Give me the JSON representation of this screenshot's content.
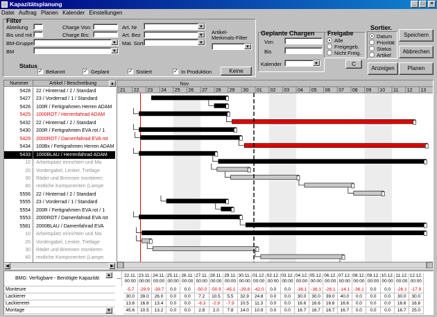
{
  "window": {
    "title": "Kapazitätsplanung",
    "min": "_",
    "max": "□",
    "close": "×"
  },
  "menu": [
    "Datei",
    "Auftrag",
    "Planen",
    "Kalender",
    "Einstellungen"
  ],
  "filter": {
    "heading": "Filter",
    "abteilung": "Abteilung",
    "bis_und_mit": "Bis und mit",
    "charge_von": "Charge Von:",
    "charge_bis": "Charge Bis:",
    "bm_gruppe": "BM-Gruppe",
    "bm": "BM",
    "art_nr": "Art. Nr",
    "art_bez": "Art. Bez",
    "mat_sorte": "Mat. Sorte",
    "artikel_merkmals_filter": [
      "Artikel-",
      "Merkmals-Filter"
    ]
  },
  "status": {
    "heading": "Status",
    "checks": [
      {
        "label": "Bekannt",
        "checked": true
      },
      {
        "label": "Geplant",
        "checked": true
      },
      {
        "label": "Sistiert",
        "checked": true
      },
      {
        "label": "In Produktion",
        "checked": true
      }
    ],
    "none_button": "Keine"
  },
  "geplante_chargen": {
    "heading": "Geplante Chargen",
    "von": "Von",
    "bis": "Bis",
    "kalender": "Kalender",
    "c_button": "C"
  },
  "freigabe": {
    "heading": "Freigabe",
    "options": [
      {
        "label": "Alle",
        "selected": true
      },
      {
        "label": "Freigegeb.",
        "selected": false
      },
      {
        "label": "Nicht Freig.",
        "selected": false
      }
    ]
  },
  "sortier": {
    "heading": "Sortier.",
    "options": [
      {
        "label": "Datum",
        "selected": true
      },
      {
        "label": "Priorität",
        "selected": false
      },
      {
        "label": "Status",
        "selected": false
      },
      {
        "label": "Artikel",
        "selected": false
      }
    ]
  },
  "buttons": {
    "speichern": "Speichern",
    "abbrechen": "Abbrechen",
    "anzeigen": "Anzeigen",
    "planen": "Planen"
  },
  "list": {
    "col_nummer": "Nummer",
    "col_artikel": "Artikel / Beschreibung",
    "rows": [
      {
        "num": "5428",
        "text": "22 / Hinterrad / 2 / Standard",
        "kind": "normal"
      },
      {
        "num": "5427",
        "text": "23 / Vorderrad / 1 / Standard",
        "kind": "normal"
      },
      {
        "num": "5426",
        "text": "100R / Fertigrahmen Herren ADAM",
        "kind": "normal"
      },
      {
        "num": "5425",
        "text": "1000ROT / Herrenfahrad ADAM",
        "kind": "red"
      },
      {
        "num": "5432",
        "text": "22 / Hinterrad / 2 / Standard",
        "kind": "normal"
      },
      {
        "num": "5430",
        "text": "200R / Fertigrahmen EVA rot / 1",
        "kind": "normal"
      },
      {
        "num": "5429",
        "text": "2000ROT / Damenfahrad EVA rot",
        "kind": "red"
      },
      {
        "num": "5434",
        "text": "100Bx / Fertigrahmen Herren ADAM",
        "kind": "normal"
      },
      {
        "num": "5433",
        "text": "1000BLAU / Herrenfahrad ADAM",
        "kind": "sel"
      },
      {
        "num": "10",
        "text": "Arbeitsplatz einrichten und Ma",
        "kind": "sub"
      },
      {
        "num": "20",
        "text": "Vordergabel, Lenker, Tretlage",
        "kind": "sub"
      },
      {
        "num": "30",
        "text": "Räder und Bremsen montieren",
        "kind": "sub"
      },
      {
        "num": "40",
        "text": "restliche Komponenten (Lampe",
        "kind": "sub"
      },
      {
        "num": "5556",
        "text": "22 / Hinterrad / 2 / Standard",
        "kind": "normal"
      },
      {
        "num": "5555",
        "text": "23 / Vorderrad / 1 / Standard",
        "kind": "normal"
      },
      {
        "num": "5554",
        "text": "200R / Fertigrahmen EVA rot / 1",
        "kind": "normal"
      },
      {
        "num": "5553",
        "text": "2000ROT / Damenfahrad EVA rot",
        "kind": "normal"
      },
      {
        "num": "5581",
        "text": "2000BLAU / Damenfahrad EVA",
        "kind": "normal"
      },
      {
        "num": "10",
        "text": "Arbeitsplatz einrichten und Ma",
        "kind": "sub"
      },
      {
        "num": "20",
        "text": "Vordergabel, Lenker, Tretlage",
        "kind": "sub"
      },
      {
        "num": "30",
        "text": "Räder und Bremsen montieren",
        "kind": "sub"
      },
      {
        "num": "40",
        "text": "restliche Komponenten (Lampe",
        "kind": "sub"
      }
    ]
  },
  "gantt": {
    "month": "Nov",
    "days": [
      "21",
      "22",
      "23",
      "24",
      "25",
      "26",
      "27",
      "28",
      "29",
      "30",
      "01",
      "02",
      "03",
      "04",
      "05",
      "06",
      "07",
      "08",
      "09",
      "10",
      "11",
      "12",
      "13"
    ],
    "bars": [
      {
        "row": 0,
        "start": 2.4,
        "end": 8.0,
        "color": "black"
      },
      {
        "row": 1,
        "start": 7.0,
        "end": 8.0,
        "color": "black"
      },
      {
        "row": 2,
        "start": 1.5,
        "end": 8.1,
        "color": "black"
      },
      {
        "row": 3,
        "start": 8.3,
        "end": 21.7,
        "color": "red"
      },
      {
        "row": 4,
        "start": 1.5,
        "end": 8.6,
        "color": "black"
      },
      {
        "row": 5,
        "start": 1.6,
        "end": 9.0,
        "color": "black"
      },
      {
        "row": 6,
        "start": 9.2,
        "end": 22.6,
        "color": "red"
      },
      {
        "row": 7,
        "start": 1.5,
        "end": 7.2,
        "color": "black"
      },
      {
        "row": 8,
        "start": 7.3,
        "end": 22.5,
        "color": "black"
      },
      {
        "row": 9,
        "start": 7.2,
        "end": 9.6,
        "color": "gray"
      },
      {
        "row": 10,
        "start": 8.2,
        "end": 13.2,
        "color": "gray"
      },
      {
        "row": 11,
        "start": 13.6,
        "end": 17.2,
        "color": "gray"
      },
      {
        "row": 12,
        "start": 17.2,
        "end": 19.4,
        "color": "gray"
      },
      {
        "row": 13,
        "start": 3.5,
        "end": 8.0,
        "color": "black"
      },
      {
        "row": 14,
        "start": 7.5,
        "end": 8.4,
        "color": "black"
      },
      {
        "row": 15,
        "start": 1.5,
        "end": 9.0,
        "color": "black"
      },
      {
        "row": 16,
        "start": 9.3,
        "end": 22.5,
        "color": "black"
      },
      {
        "row": 17,
        "start": 1.7,
        "end": 22.5,
        "color": "black"
      },
      {
        "row": 18,
        "start": 1.7,
        "end": 2.4,
        "color": "gray"
      },
      {
        "row": 19,
        "start": 2.5,
        "end": 10.2,
        "color": "gray"
      },
      {
        "row": 20,
        "start": 10.4,
        "end": 16.5,
        "color": "gray"
      },
      {
        "row": 21,
        "start": 16.6,
        "end": 19.2,
        "color": "gray"
      }
    ],
    "today": 9.9
  },
  "capacity": {
    "label": "BMG: Verfügbare - Benötigte Kapazität",
    "dates": [
      "22.11.",
      "23.11.",
      "24.11.",
      "25.11.",
      "26.11.",
      "27.11.",
      "28.11.",
      "29.11.",
      "30.11.",
      "01.12.",
      "02.12.",
      "03.12.",
      "04.12.",
      "05.12.",
      "06.12.",
      "07.12.",
      "08.12.",
      "09.12.",
      "10.12.",
      "11.12.",
      "12.12."
    ],
    "time": "00:00",
    "rows": [
      {
        "name": "Monteure",
        "values": [
          "-5.7",
          "-29.9",
          "-39.7",
          "0.0",
          "0.0",
          "-50.0",
          "-50.9",
          "-45.1",
          "-29.8",
          "-42.0",
          "0.0",
          "0.0",
          "-36.1",
          "-36.1",
          "-26.1",
          "-14.1",
          "-36.1",
          "0.0",
          "0.0",
          "-26.1",
          "-17.9"
        ]
      },
      {
        "name": "Lackierer",
        "values": [
          "30.0",
          "39.0",
          "26.0",
          "0.0",
          "0.0",
          "7.2",
          "10.5",
          "5.5",
          "32.9",
          "24.8",
          "0.0",
          "0.0",
          "30.0",
          "30.0",
          "39.0",
          "40.0",
          "0.0",
          "0.0",
          "0.0",
          "30.0",
          "30.0"
        ]
      },
      {
        "name": "Lackiererei",
        "values": [
          "13.6",
          "16.6",
          "13.4",
          "0.0",
          "0.0",
          "-6.3",
          "-2.9",
          "-7.9",
          "10.5",
          "11.3",
          "0.0",
          "0.0",
          "16.6",
          "16.6",
          "16.6",
          "16.6",
          "0.0",
          "0.0",
          "0.0",
          "16.6",
          "16.6"
        ]
      },
      {
        "name": "Montage",
        "values": [
          "45.6",
          "10.5",
          "13.2",
          "0.0",
          "0.0",
          "2.8",
          "2.0",
          "7.8",
          "14.0",
          "10.9",
          "0.0",
          "0.0",
          "16.7",
          "16.7",
          "16.7",
          "16.7",
          "0.0",
          "0.0",
          "0.0",
          "16.7",
          "25.0"
        ]
      }
    ]
  }
}
